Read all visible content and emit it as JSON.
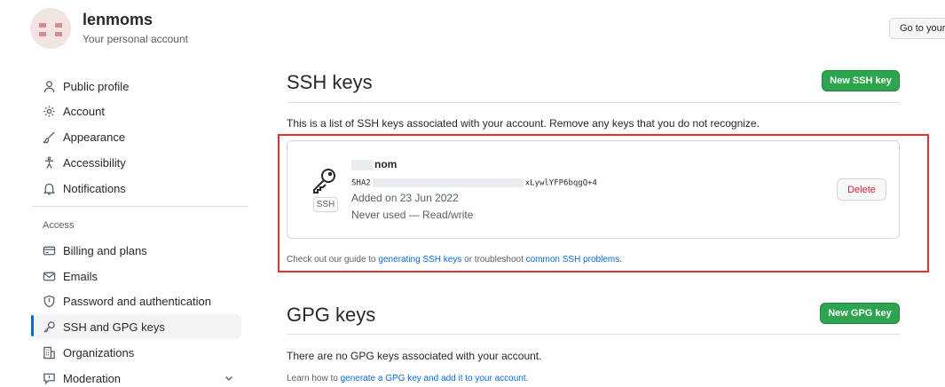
{
  "header": {
    "username": "lenmoms",
    "subtitle": "Your personal account",
    "goto_button": "Go to your"
  },
  "sidebar": {
    "items_top": [
      {
        "label": "Public profile",
        "icon": "person-icon"
      },
      {
        "label": "Account",
        "icon": "gear-icon"
      },
      {
        "label": "Appearance",
        "icon": "paintbrush-icon"
      },
      {
        "label": "Accessibility",
        "icon": "accessibility-icon"
      },
      {
        "label": "Notifications",
        "icon": "bell-icon"
      }
    ],
    "group_access": "Access",
    "items_access": [
      {
        "label": "Billing and plans",
        "icon": "credit-card-icon"
      },
      {
        "label": "Emails",
        "icon": "mail-icon"
      },
      {
        "label": "Password and authentication",
        "icon": "shield-icon"
      },
      {
        "label": "SSH and GPG keys",
        "icon": "key-icon",
        "active": true
      },
      {
        "label": "Organizations",
        "icon": "organization-icon"
      },
      {
        "label": "Moderation",
        "icon": "report-icon"
      }
    ]
  },
  "ssh": {
    "title": "SSH keys",
    "new_button": "New SSH key",
    "description": "This is a list of SSH keys associated with your account. Remove any keys that you do not recognize.",
    "key": {
      "title": "nom",
      "fingerprint_start": "SHA2",
      "fingerprint_end": "xLywlYFP6bqgQ+4",
      "type_label": "SSH",
      "added": "Added on 23 Jun 2022",
      "usage": "Never used — Read/write",
      "delete_label": "Delete"
    },
    "guide_prefix": "Check out our guide to ",
    "guide_link1": "generating SSH keys",
    "guide_middle": " or troubleshoot ",
    "guide_link2": "common SSH problems",
    "guide_suffix": "."
  },
  "gpg": {
    "title": "GPG keys",
    "new_button": "New GPG key",
    "empty_text": "There are no GPG keys associated with your account.",
    "learn_prefix": "Learn how to ",
    "learn_link": "generate a GPG key and add it to your account",
    "learn_suffix": "."
  },
  "colors": {
    "accent": "#0969da",
    "primary_button": "#2da44e",
    "danger": "#cf222e",
    "highlight_box": "#e5302f"
  }
}
